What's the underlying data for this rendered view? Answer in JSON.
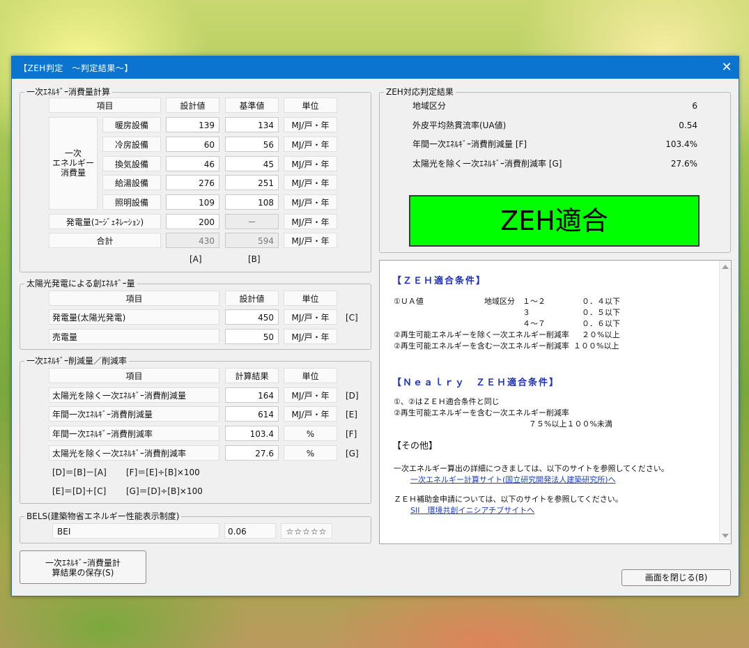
{
  "window": {
    "title": "【ZEH判定　～判定結果～】",
    "close_glyph": "✕"
  },
  "primary": {
    "legend": "一次ｴﾈﾙｷﾞｰ消費量計算",
    "headers": {
      "item": "項目",
      "design": "設計値",
      "standard": "基準値",
      "unit": "単位"
    },
    "group_label": "一次\nエネルギー\n消費量",
    "rows": [
      {
        "label": "暖房設備",
        "design": "139",
        "standard": "134",
        "unit": "MJ/戸・年"
      },
      {
        "label": "冷房設備",
        "design": "60",
        "standard": "56",
        "unit": "MJ/戸・年"
      },
      {
        "label": "換気設備",
        "design": "46",
        "standard": "45",
        "unit": "MJ/戸・年"
      },
      {
        "label": "給湯設備",
        "design": "276",
        "standard": "251",
        "unit": "MJ/戸・年"
      },
      {
        "label": "照明設備",
        "design": "109",
        "standard": "108",
        "unit": "MJ/戸・年"
      }
    ],
    "cogen": {
      "label": "発電量(ｺｰｼﾞｪﾈﾚｰｼｮﾝ)",
      "design": "200",
      "standard": "－",
      "unit": "MJ/戸・年"
    },
    "total": {
      "label": "合計",
      "design": "430",
      "standard": "594",
      "unit": "MJ/戸・年"
    },
    "refs": {
      "a": "[A]",
      "b": "[B]"
    }
  },
  "solar": {
    "legend": "太陽光発電による創ｴﾈﾙｷﾞｰ量",
    "headers": {
      "item": "項目",
      "design": "設計値",
      "unit": "単位"
    },
    "rows": [
      {
        "label": "発電量(太陽光発電)",
        "value": "450",
        "unit": "MJ/戸・年",
        "ref": "[C]"
      },
      {
        "label": "売電量",
        "value": "50",
        "unit": "MJ/戸・年",
        "ref": ""
      }
    ]
  },
  "reduction": {
    "legend": "一次ｴﾈﾙｷﾞｰ削減量／削減率",
    "headers": {
      "item": "項目",
      "result": "計算結果",
      "unit": "単位"
    },
    "rows": [
      {
        "label": "太陽光を除く一次ｴﾈﾙｷﾞｰ消費削減量",
        "value": "164",
        "unit": "MJ/戸・年",
        "ref": "[D]"
      },
      {
        "label": "年間一次ｴﾈﾙｷﾞｰ消費削減量",
        "value": "614",
        "unit": "MJ/戸・年",
        "ref": "[E]"
      },
      {
        "label": "年間一次ｴﾈﾙｷﾞｰ消費削減率",
        "value": "103.4",
        "unit": "%",
        "ref": "[F]"
      },
      {
        "label": "太陽光を除く一次ｴﾈﾙｷﾞｰ消費削減率",
        "value": "27.6",
        "unit": "%",
        "ref": "[G]"
      }
    ],
    "formulas": {
      "d": "[D]＝[B]－[A]",
      "f": "[F]＝[E]÷[B]×100",
      "e": "[E]＝[D]＋[C]",
      "g": "[G]＝[D]÷[B]×100"
    }
  },
  "bels": {
    "legend": "BELS(建築物省エネルギー性能表示制度)",
    "label": "BEI",
    "value": "0.06",
    "stars": "☆☆☆☆☆"
  },
  "zeh_result": {
    "legend": "ZEH対応判定結果",
    "rows": [
      {
        "label": "地域区分",
        "value": "6"
      },
      {
        "label": "外皮平均熱貫流率(UA値)",
        "value": "0.54"
      },
      {
        "label": "年間一次ｴﾈﾙｷﾞｰ消費削減量 [F]",
        "value": "103.4%"
      },
      {
        "label": "太陽光を除く一次ｴﾈﾙｷﾞｰ消費削減率 [G]",
        "value": "27.6%"
      }
    ],
    "verdict": "ZEH適合",
    "verdict_color": "#00ff00"
  },
  "info": {
    "zeh_title": "【ＺＥＨ適合条件】",
    "ua_label": "①ＵＡ値",
    "region_label": "地域区分",
    "ua_rows": [
      {
        "region": "１～２",
        "limit": "０．４以下"
      },
      {
        "region": "３",
        "limit": "０．５以下"
      },
      {
        "region": "４～７",
        "limit": "０．６以下"
      }
    ],
    "cond2a": "②再生可能エネルギーを除く一次エネルギー削減率",
    "cond2a_val": "２０%以上",
    "cond2b": "②再生可能エネルギーを含む一次エネルギー削減率",
    "cond2b_val": "１００%以上",
    "nearly_title": "【Ｎｅａｌｒｙ　ＺＥＨ適合条件】",
    "nearly_1": "①、②はＺＥＨ適合条件と同じ",
    "nearly_2": "②再生可能エネルギーを含む一次エネルギー削減率",
    "nearly_3": "７５%以上１００%未満",
    "other_title": "【その他】",
    "other_1": "一次エネルギー算出の詳細につきましては、以下のサイトを参照してください。",
    "link_1": "一次エネルギー計算サイト(国立研究開発法人建築研究所)へ",
    "other_2": "ＺＥＨ補助金申請については、以下のサイトを参照してください。",
    "link_2": "SII　環境共創イニシアチブサイトへ"
  },
  "buttons": {
    "save": "一次ｴﾈﾙｷﾞｰ消費量計\n算結果の保存(S)",
    "close": "画面を閉じる(B)"
  }
}
